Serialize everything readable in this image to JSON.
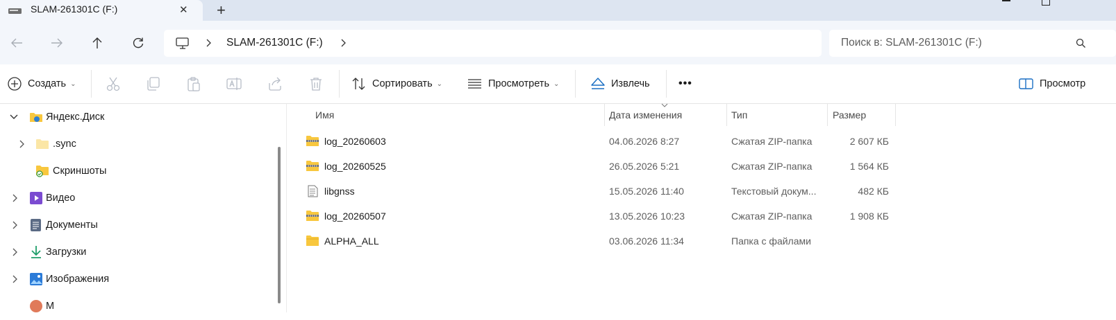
{
  "window": {
    "tab_title": "SLAM-261301C (F:)",
    "new_tab_symbol": "+",
    "tab_close_symbol": "✕"
  },
  "address": {
    "segment": "SLAM-261301C (F:)",
    "search_placeholder": "Поиск в: SLAM-261301C (F:)"
  },
  "toolbar": {
    "create": "Создать",
    "sort": "Сортировать",
    "view": "Просмотреть",
    "extract": "Извлечь",
    "more": "•••",
    "preview": "Просмотр"
  },
  "nav": {
    "items": [
      {
        "label": "Яндекс.Диск",
        "icon": "yandex-disk-icon",
        "expanded": true
      },
      {
        "label": ".sync",
        "icon": "folder-icon",
        "expanded": false
      },
      {
        "label": "Скриншоты",
        "icon": "folder-synced-icon",
        "expanded": false
      },
      {
        "label": "Видео",
        "icon": "video-icon",
        "expanded": false
      },
      {
        "label": "Документы",
        "icon": "documents-icon",
        "expanded": false
      },
      {
        "label": "Загрузки",
        "icon": "download-icon",
        "expanded": false
      },
      {
        "label": "Изображения",
        "icon": "pictures-icon",
        "expanded": false
      },
      {
        "label": "М",
        "icon": "music-icon",
        "expanded": false
      }
    ]
  },
  "list": {
    "columns": {
      "name": "Имя",
      "date": "Дата изменения",
      "type": "Тип",
      "size": "Размер"
    },
    "rows": [
      {
        "name": "log_20260603",
        "date": "04.06.2026 8:27",
        "type": "Сжатая ZIP-папка",
        "size": "2 607 КБ",
        "icon": "zip-folder-icon"
      },
      {
        "name": "log_20260525",
        "date": "26.05.2026 5:21",
        "type": "Сжатая ZIP-папка",
        "size": "1 564 КБ",
        "icon": "zip-folder-icon"
      },
      {
        "name": "libgnss",
        "date": "15.05.2026 11:40",
        "type": "Текстовый докум...",
        "size": "482 КБ",
        "icon": "text-file-icon"
      },
      {
        "name": "log_20260507",
        "date": "13.05.2026 10:23",
        "type": "Сжатая ZIP-папка",
        "size": "1 908 КБ",
        "icon": "zip-folder-icon"
      },
      {
        "name": "ALPHA_ALL",
        "date": "03.06.2026 11:34",
        "type": "Папка с файлами",
        "size": "",
        "icon": "folder-icon"
      }
    ]
  },
  "colors": {
    "tabstrip_bg": "#dde5f1",
    "toolbar_bg": "#f3f6fb",
    "folder_yellow": "#f8c73e",
    "accent_blue": "#1a6fc4"
  }
}
